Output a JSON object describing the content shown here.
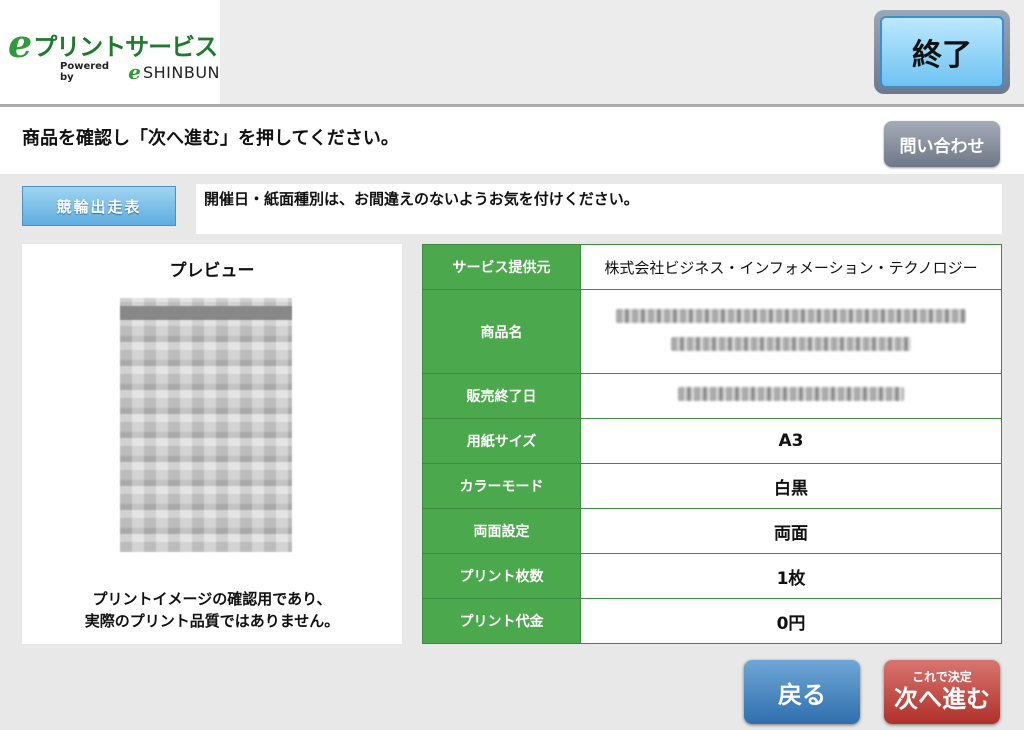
{
  "header": {
    "logo_e": "e",
    "logo_text": "プリントサービス",
    "powered_by": "Powered by",
    "powered_e": "e",
    "powered_brand": "SHINBUN",
    "end_button": "終了"
  },
  "instruction": {
    "text": "商品を確認し「次へ進む」を押してください。",
    "inquiry_button": "問い合わせ"
  },
  "category_badge": "競輪出走表",
  "notice": "開催日・紙面種別は、お間違えのないようお気を付けください。",
  "preview": {
    "title": "プレビュー",
    "note_line1": "プリントイメージの確認用であり、",
    "note_line2": "実際のプリント品質ではありません。"
  },
  "details": [
    {
      "label": "サービス提供元",
      "value": "株式会社ビジネス・インフォメーション・テクノロジー"
    },
    {
      "label": "商品名",
      "value": ""
    },
    {
      "label": "販売終了日",
      "value": ""
    },
    {
      "label": "用紙サイズ",
      "value": "A3"
    },
    {
      "label": "カラーモード",
      "value": "白黒"
    },
    {
      "label": "両面設定",
      "value": "両面"
    },
    {
      "label": "プリント枚数",
      "value": "1枚"
    },
    {
      "label": "プリント代金",
      "value": "0円"
    }
  ],
  "footer": {
    "back_button": "戻る",
    "next_small": "これで決定",
    "next_big": "次へ進む"
  },
  "colors": {
    "table_label_bg": "#4ca84c",
    "table_border": "#3d8b3d",
    "end_button": "#6ec3f2",
    "back_button": "#2f6fae",
    "next_button": "#b0302a"
  }
}
